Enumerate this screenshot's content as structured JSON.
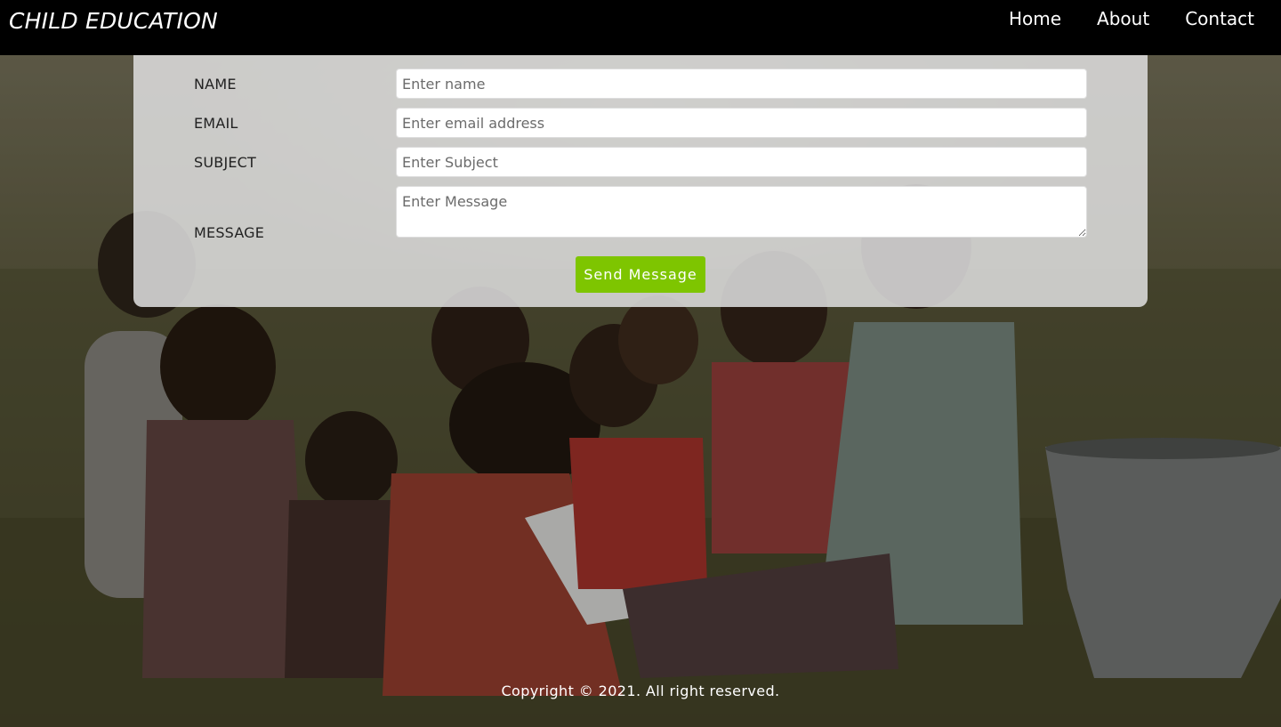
{
  "header": {
    "brand": "CHILD EDUCATION",
    "nav": [
      {
        "label": "Home"
      },
      {
        "label": "About"
      },
      {
        "label": "Contact"
      }
    ]
  },
  "form": {
    "name": {
      "label": "NAME",
      "placeholder": "Enter name",
      "value": ""
    },
    "email": {
      "label": "EMAIL",
      "placeholder": "Enter email address",
      "value": ""
    },
    "subject": {
      "label": "SUBJECT",
      "placeholder": "Enter Subject",
      "value": ""
    },
    "message": {
      "label": "MESSAGE",
      "placeholder": "Enter Message",
      "value": ""
    },
    "submit_label": "Send Message",
    "submit_color": "#7ec500"
  },
  "footer": {
    "copyright": "Copyright © 2021. All right reserved."
  },
  "background": {
    "image": "children-sitting-on-grass-photo"
  }
}
